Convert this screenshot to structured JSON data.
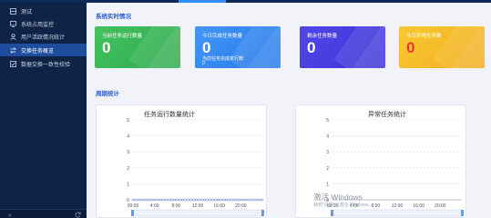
{
  "sidebar": {
    "items": [
      {
        "label": "测试",
        "icon": "grid-icon"
      },
      {
        "label": "系统占用监控",
        "icon": "monitor-icon"
      },
      {
        "label": "用户活跃情况统计",
        "icon": "user-icon"
      },
      {
        "label": "交换任务概览",
        "icon": "exchange-icon",
        "active": true
      },
      {
        "label": "数据交换一致性校验",
        "icon": "check-icon"
      }
    ],
    "footer": {
      "collapse_icon": "double-chevron-left-icon",
      "refresh_icon": "refresh-icon"
    }
  },
  "realtime": {
    "title": "系统实时情况",
    "cards": [
      {
        "label": "当前任务运行数量",
        "value": "0",
        "color_from": "#3dbd5a",
        "color_to": "#2ea84e"
      },
      {
        "label": "今日完成任务数量",
        "value": "0",
        "sub_label": "当前任务完成未行数:",
        "sub_value": "0",
        "color_from": "#3a8df5",
        "color_to": "#2478ea"
      },
      {
        "label": "剩余任务数量",
        "value": "0",
        "color_from": "#4a40e6",
        "color_to": "#3b31d6"
      },
      {
        "label": "今日异常任务数",
        "value": "0",
        "value_color": "#e33b2c",
        "color_from": "#f7c226",
        "color_to": "#f2ad1d"
      }
    ]
  },
  "periodic": {
    "title": "周期统计",
    "charts": [
      {
        "title": "任务运行数量统计",
        "y_ticks": [
          "5",
          "4",
          "3",
          "2",
          "1",
          "0"
        ],
        "x_ticks": [
          "00:00",
          "4:00",
          "8:00",
          "12:00",
          "16:00",
          "20:00"
        ],
        "ylim": [
          0,
          5
        ],
        "series": [
          {
            "values": [
              0,
              0,
              0,
              0,
              0,
              0,
              0,
              0,
              0,
              0,
              0,
              0,
              0,
              0,
              0,
              0,
              0,
              0,
              0,
              0,
              0,
              0,
              0,
              0,
              0,
              0,
              0,
              0,
              0,
              0,
              0,
              0,
              0,
              0,
              0,
              0,
              0,
              0,
              0,
              0,
              0,
              0,
              0,
              0,
              0,
              0,
              0,
              0
            ]
          }
        ],
        "line_color": "#5a7fc4"
      },
      {
        "title": "异常任务统计",
        "y_ticks": [
          "5",
          "4",
          "3",
          "2",
          "1",
          "0"
        ],
        "x_ticks": [
          "00:00",
          "4:00",
          "8:00",
          "12:00",
          "16:00",
          "20:00"
        ],
        "ylim": [
          0,
          5
        ],
        "series": [
          {
            "values": []
          }
        ],
        "line_color": "#5a7fc4"
      }
    ]
  },
  "watermark": {
    "line1": "激活 Windows",
    "line2": "转到\"设置\"以激活 Windows。"
  },
  "colors": {
    "accent": "#2f63c8",
    "sidebar_bg": "#0f2346",
    "sidebar_active": "#1d4d9c"
  }
}
